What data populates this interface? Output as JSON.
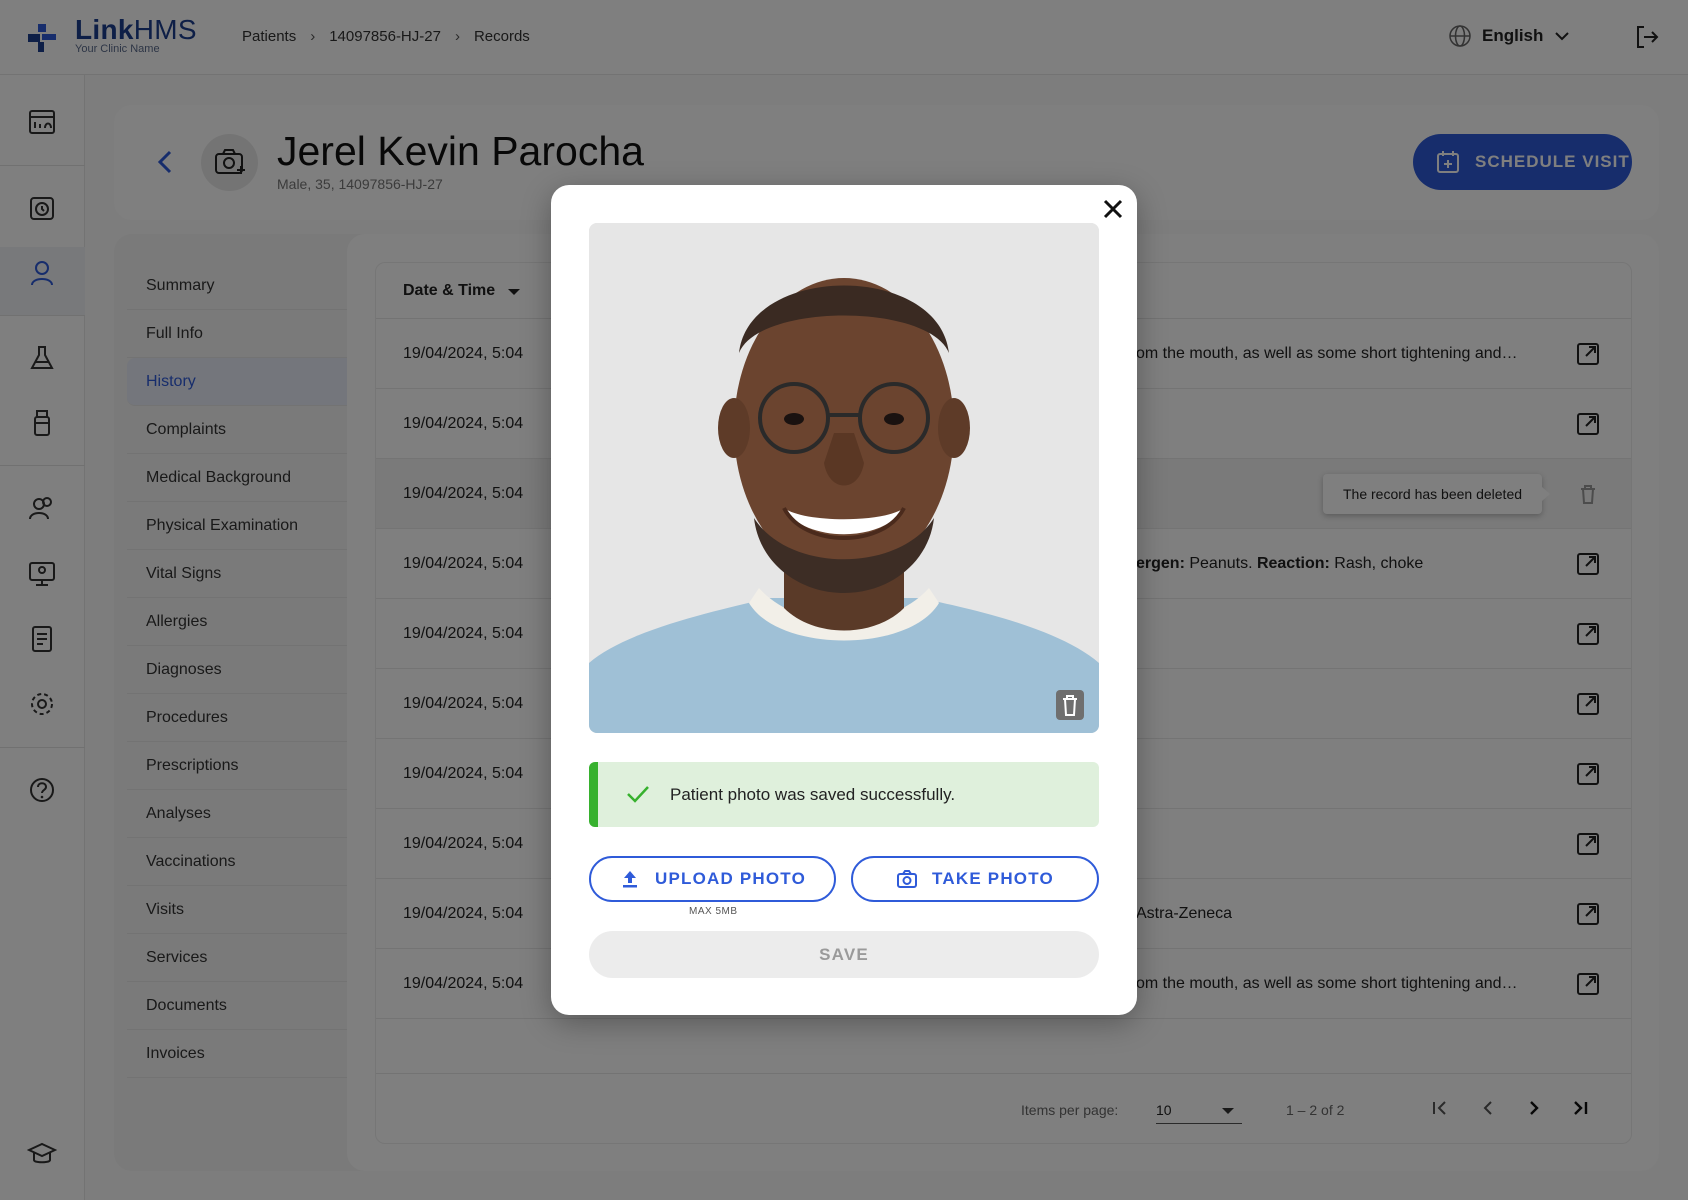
{
  "brand": {
    "name_part1": "Link",
    "name_part2": "HMS",
    "subtitle": "Your Clinic Name",
    "color": "#1d3f8f"
  },
  "breadcrumb": [
    "Patients",
    "14097856-HJ-27",
    "Records"
  ],
  "language": {
    "selected": "English"
  },
  "patient": {
    "name": "Jerel Kevin Parocha",
    "meta": "Male, 35, 14097856-HJ-27"
  },
  "schedule_button": {
    "label": "SCHEDULE VISIT",
    "color": "#2f5bd9"
  },
  "side_nav": [
    {
      "label": "Summary",
      "active": false
    },
    {
      "label": "Full Info",
      "active": false
    },
    {
      "label": "History",
      "active": true
    },
    {
      "label": "Complaints",
      "active": false
    },
    {
      "label": "Medical Background",
      "active": false
    },
    {
      "label": "Physical Examination",
      "active": false
    },
    {
      "label": "Vital Signs",
      "active": false
    },
    {
      "label": "Allergies",
      "active": false
    },
    {
      "label": "Diagnoses",
      "active": false
    },
    {
      "label": "Procedures",
      "active": false
    },
    {
      "label": "Prescriptions",
      "active": false
    },
    {
      "label": "Analyses",
      "active": false
    },
    {
      "label": "Vaccinations",
      "active": false
    },
    {
      "label": "Visits",
      "active": false
    },
    {
      "label": "Services",
      "active": false
    },
    {
      "label": "Documents",
      "active": false
    },
    {
      "label": "Invoices",
      "active": false
    }
  ],
  "table": {
    "header_datetime": "Date & Time",
    "rows": [
      {
        "datetime": "19/04/2024, 5:04",
        "desc": "om the mouth, as well as some short tightening and…",
        "action": "open"
      },
      {
        "datetime": "19/04/2024, 5:04",
        "desc": "",
        "action": "open"
      },
      {
        "datetime": "19/04/2024, 5:04",
        "desc": "",
        "action": "deleted",
        "tooltip": "The record has been deleted"
      },
      {
        "datetime": "19/04/2024, 5:04",
        "desc_b1": "ergen:",
        "desc_t1": " Peanuts. ",
        "desc_b2": "Reaction:",
        "desc_t2": " Rash, choke",
        "action": "open"
      },
      {
        "datetime": "19/04/2024, 5:04",
        "desc": "",
        "action": "open"
      },
      {
        "datetime": "19/04/2024, 5:04",
        "desc": "",
        "action": "open"
      },
      {
        "datetime": "19/04/2024, 5:04",
        "desc": "",
        "action": "open"
      },
      {
        "datetime": "19/04/2024, 5:04",
        "desc": "",
        "action": "open"
      },
      {
        "datetime": "19/04/2024, 5:04",
        "desc": "Astra-Zeneca",
        "action": "open"
      },
      {
        "datetime": "19/04/2024, 5:04",
        "desc": "om the mouth, as well as some short tightening and…",
        "action": "open"
      }
    ]
  },
  "pager": {
    "items_per_page_label": "Items per page:",
    "items_per_page": "10",
    "range": "1 – 2 of 2"
  },
  "modal": {
    "success_message": "Patient photo was saved successfully.",
    "upload_label": "UPLOAD PHOTO",
    "take_label": "TAKE PHOTO",
    "max_size": "MAX 5MB",
    "save_label": "SAVE",
    "success_color": "#37b12e"
  }
}
